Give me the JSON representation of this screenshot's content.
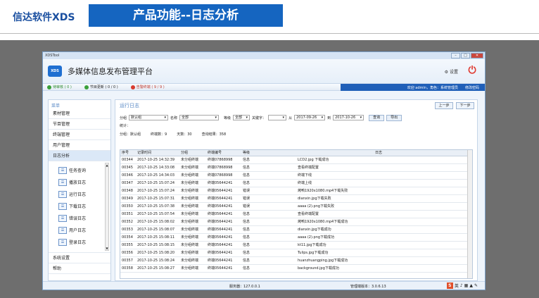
{
  "slide": {
    "brand": "信达软件XDS",
    "banner": "产品功能--日志分析"
  },
  "window": {
    "tool_title": "XDSTool",
    "controls": [
      "–",
      "□",
      "✕"
    ]
  },
  "app": {
    "logo": "XDS",
    "title": "多媒体信息发布管理平台",
    "settings": "设置"
  },
  "status": {
    "items": [
      {
        "text": "待审核 ( 0 )",
        "color": "#3aa03a"
      },
      {
        "text": "节目更新 ( 0 / 0 )",
        "color": "#3aa03a"
      },
      {
        "text": "告警终端 ( 9 / 9 )",
        "color": "#d83a2e"
      }
    ],
    "welcome": "欢迎 admin，角色：系统管理员",
    "change_pwd": "修改密码"
  },
  "sidebar": {
    "header": "菜单",
    "items": [
      "素材管理",
      "节目管理",
      "终端管理",
      "用户管理",
      "日志分析"
    ],
    "sub_items": [
      "任务查询",
      "播放日志",
      "运行日志",
      "下载日志",
      "错误日志",
      "用户日志",
      "登录日志"
    ],
    "bottom_items": [
      "系统设置",
      "帮助"
    ]
  },
  "content": {
    "title": "运行日志",
    "prev": "上一步",
    "next": "下一步",
    "filter": {
      "group_label": "分组",
      "group_value": "默认组",
      "name_label": "名称",
      "name_value": "全部",
      "level_label": "等级",
      "level_value": "全部",
      "keyword_label": "关键字：",
      "from_label": "从",
      "from_value": "2017-09-26",
      "to_label": "到",
      "to_value": "2017-10-26",
      "query": "查询",
      "export": "导出"
    },
    "stats_label": "统计：",
    "stats": [
      "分组：默认组",
      "终端数：9",
      "天数：30",
      "查询结果：358"
    ]
  },
  "table": {
    "headers": [
      "序号",
      "记录时间",
      "分组",
      "终端编号",
      "等级",
      "日志"
    ],
    "rows": [
      [
        "00344",
        "2017-10-25 14:32:39",
        "未分组终端",
        "终端07868998",
        "信息",
        "LCD2.jpg 下载成功"
      ],
      [
        "00345",
        "2017-10-25 14:33:08",
        "未分组终端",
        "终端07868998",
        "信息",
        "查看终端配置"
      ],
      [
        "00346",
        "2017-10-25 14:34:03",
        "未分组终端",
        "终端07868998",
        "信息",
        "终端下线"
      ],
      [
        "00347",
        "2017-10-25 15:07:24",
        "未分组终端",
        "终端05644241",
        "信息",
        "终端上线"
      ],
      [
        "00348",
        "2017-10-25 15:07:24",
        "未分组终端",
        "终端05644241",
        "错误",
        "烤鸭1920x1080.mp4下载失败"
      ],
      [
        "00349",
        "2017-10-25 15:07:31",
        "未分组终端",
        "终端05644241",
        "错误",
        "dianxin.jpg下载失败"
      ],
      [
        "00350",
        "2017-10-25 15:07:38",
        "未分组终端",
        "终端05644241",
        "错误",
        "aaaa (2).png下载失败"
      ],
      [
        "00351",
        "2017-10-25 15:07:54",
        "未分组终端",
        "终端05644241",
        "信息",
        "查看终端配置"
      ],
      [
        "00352",
        "2017-10-25 15:08:02",
        "未分组终端",
        "终端05644241",
        "信息",
        "烤鸭1920x1080.mp4下载成功"
      ],
      [
        "00353",
        "2017-10-25 15:08:07",
        "未分组终端",
        "终端05644241",
        "信息",
        "dianxin.jpg下载成功"
      ],
      [
        "00354",
        "2017-10-25 15:08:11",
        "未分组终端",
        "终端05644241",
        "信息",
        "aaaa (2).png下载成功"
      ],
      [
        "00355",
        "2017-10-25 15:08:15",
        "未分组终端",
        "终端05644241",
        "信息",
        "kt11.jpg下载成功"
      ],
      [
        "00356",
        "2017-10-25 15:08:20",
        "未分组终端",
        "终端05644241",
        "信息",
        "Tulips.jpg下载成功"
      ],
      [
        "00357",
        "2017-10-25 15:08:24",
        "未分组终端",
        "终端05644241",
        "信息",
        "huanzhuangping.jpg下载成功"
      ],
      [
        "00358",
        "2017-10-25 15:08:27",
        "未分组终端",
        "终端05644241",
        "信息",
        "background.jpg下载成功"
      ]
    ]
  },
  "footer": {
    "server": "服务器：127.0.0.1",
    "version": "管理端版本：3.0.6.13",
    "ime": "英"
  }
}
